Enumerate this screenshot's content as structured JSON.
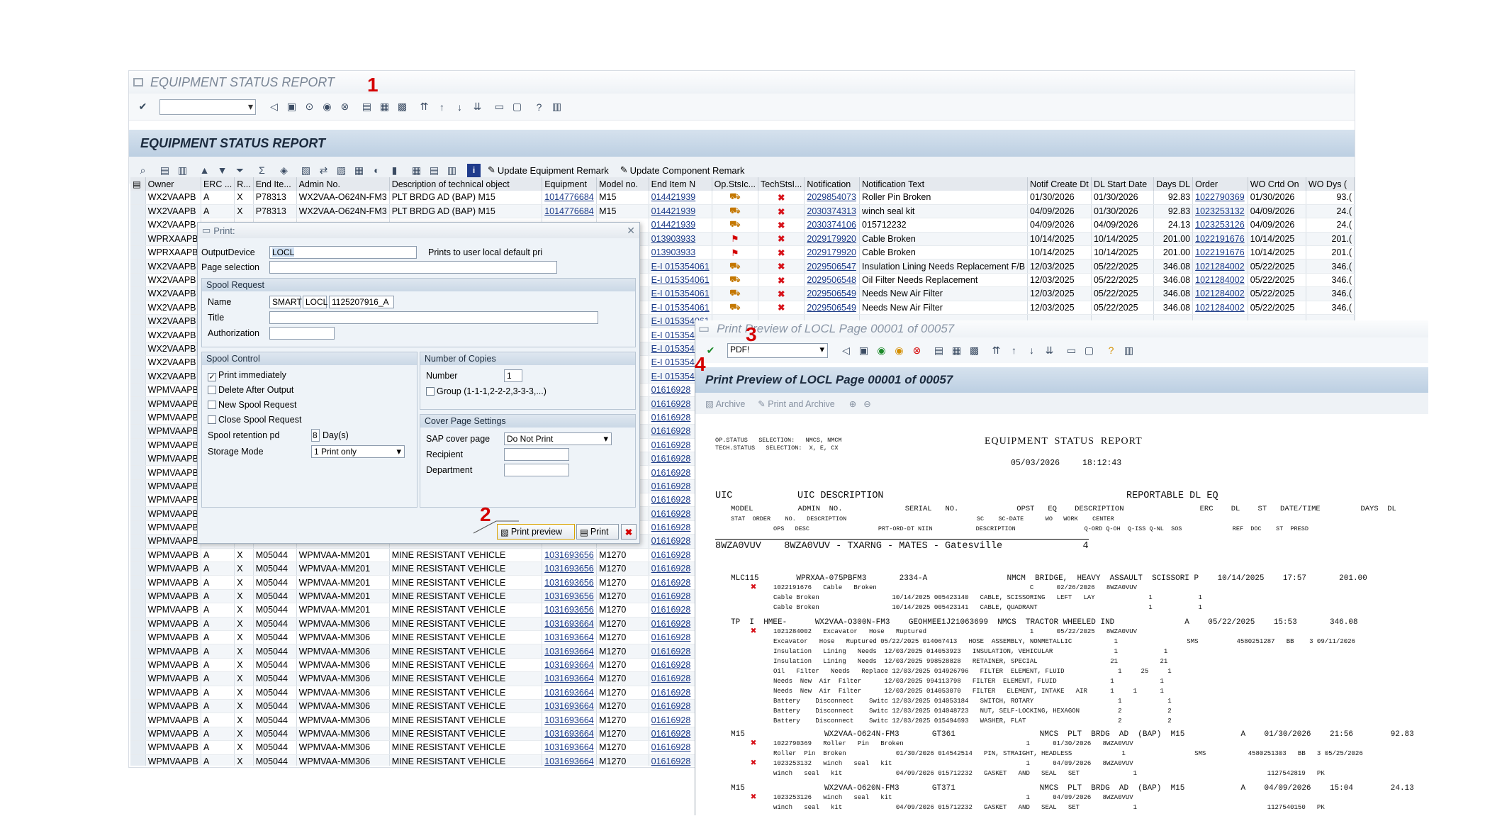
{
  "main_window": {
    "title": "EQUIPMENT STATUS REPORT",
    "app_title": "EQUIPMENT STATUS REPORT",
    "app_buttons": {
      "update_equipment": "Update Equipment Remark",
      "update_component": "Update Component Remark"
    }
  },
  "grid": {
    "columns": [
      "Owner",
      "ERC ...",
      "R...",
      "End Ite...",
      "Admin No.",
      "Description of technical object",
      "Equipment",
      "Model no.",
      "End Item N",
      "Op.StsIc...",
      "TechStsI...",
      "Notification",
      "Notification Text",
      "Notif Create Dt",
      "DL Start Date",
      "Days DL",
      "Order",
      "WO Crtd On",
      "WO Dys ("
    ],
    "rows": [
      [
        "WX2VAAPB",
        "A",
        "X",
        "P78313",
        "WX2VAA-O624N-FM3",
        "PLT BRDG AD (BAP) M15",
        "1014776684",
        "M15",
        "014421939",
        "truck",
        "x",
        "2029854073",
        "Roller Pin Broken",
        "01/30/2026",
        "01/30/2026",
        "92.83",
        "1022790369",
        "01/30/2026",
        "93.("
      ],
      [
        "WX2VAAPB",
        "A",
        "X",
        "P78313",
        "WX2VAA-O624N-FM3",
        "PLT BRDG AD (BAP) M15",
        "1014776684",
        "M15",
        "014421939",
        "truck",
        "x",
        "2030374313",
        "winch seal kit",
        "04/09/2026",
        "01/30/2026",
        "92.83",
        "1023253132",
        "04/09/2026",
        "24.("
      ],
      [
        "WX2VAAPB",
        "",
        "",
        "",
        "",
        "",
        "",
        "",
        "014421939",
        "truck",
        "x",
        "2030374106",
        "015712232",
        "04/09/2026",
        "04/09/2026",
        "24.13",
        "1023253126",
        "04/09/2026",
        "24.("
      ],
      [
        "WPRXAAPB",
        "",
        "",
        "",
        "",
        "",
        "",
        "",
        "013903933",
        "flag",
        "x",
        "2029179920",
        "Cable Broken",
        "10/14/2025",
        "10/14/2025",
        "201.00",
        "1022191676",
        "10/14/2025",
        "201.("
      ],
      [
        "WPRXAAPB",
        "",
        "",
        "",
        "",
        "",
        "",
        "",
        "013903933",
        "flag",
        "x",
        "2029179920",
        "Cable Broken",
        "10/14/2025",
        "10/14/2025",
        "201.00",
        "1022191676",
        "10/14/2025",
        "201.("
      ],
      [
        "WX2VAAPB",
        "",
        "",
        "",
        "",
        "",
        "",
        "",
        "E-I 015354061",
        "truck",
        "x",
        "2029506547",
        "Insulation Lining Needs Replacement F/B",
        "12/03/2025",
        "05/22/2025",
        "346.08",
        "1021284002",
        "05/22/2025",
        "346.("
      ],
      [
        "WX2VAAPB",
        "",
        "",
        "",
        "",
        "",
        "",
        "",
        "E-I 015354061",
        "truck",
        "x",
        "2029506548",
        "Oil Filter Needs Replacement",
        "12/03/2025",
        "05/22/2025",
        "346.08",
        "1021284002",
        "05/22/2025",
        "346.("
      ],
      [
        "WX2VAAPB",
        "",
        "",
        "",
        "",
        "",
        "",
        "",
        "E-I 015354061",
        "truck",
        "x",
        "2029506549",
        "Needs New Air Filter",
        "12/03/2025",
        "05/22/2025",
        "346.08",
        "1021284002",
        "05/22/2025",
        "346.("
      ],
      [
        "WX2VAAPB",
        "",
        "",
        "",
        "",
        "",
        "",
        "",
        "E-I 015354061",
        "truck",
        "x",
        "2029506549",
        "Needs New Air Filter",
        "12/03/2025",
        "05/22/2025",
        "346.08",
        "1021284002",
        "05/22/2025",
        "346.("
      ],
      [
        "WX2VAAPB",
        "",
        "",
        "",
        "",
        "",
        "",
        "",
        "E-I 015354061",
        "",
        "",
        "",
        "",
        "",
        "",
        "",
        "",
        "",
        ""
      ],
      [
        "WX2VAAPB",
        "",
        "",
        "",
        "",
        "",
        "",
        "",
        "E-I 015354061",
        "",
        "",
        "",
        "",
        "",
        "",
        "",
        "",
        "",
        ""
      ],
      [
        "WX2VAAPB",
        "",
        "",
        "",
        "",
        "",
        "",
        "",
        "E-I 015354061",
        "",
        "",
        "",
        "",
        "",
        "",
        "",
        "",
        "",
        ""
      ],
      [
        "WX2VAAPB",
        "",
        "",
        "",
        "",
        "",
        "",
        "",
        "E-I 015354061",
        "",
        "",
        "",
        "",
        "",
        "",
        "",
        "",
        "",
        ""
      ],
      [
        "WX2VAAPB",
        "",
        "",
        "",
        "",
        "",
        "",
        "",
        "E-I 015354061",
        "",
        "",
        "",
        "",
        "",
        "",
        "",
        "",
        "",
        ""
      ],
      [
        "WPMVAAPB",
        "",
        "",
        "",
        "",
        "",
        "",
        "",
        "01616928",
        "",
        "",
        "",
        "",
        "",
        "",
        "",
        "",
        "",
        ""
      ],
      [
        "WPMVAAPB",
        "",
        "",
        "",
        "",
        "",
        "",
        "",
        "01616928",
        "",
        "",
        "",
        "",
        "",
        "",
        "",
        "",
        "",
        ""
      ],
      [
        "WPMVAAPB",
        "",
        "",
        "",
        "",
        "",
        "",
        "",
        "01616928",
        "",
        "",
        "",
        "",
        "",
        "",
        "",
        "",
        "",
        ""
      ],
      [
        "WPMVAAPB",
        "",
        "",
        "",
        "",
        "",
        "",
        "",
        "01616928",
        "",
        "",
        "",
        "",
        "",
        "",
        "",
        "",
        "",
        ""
      ],
      [
        "WPMVAAPB",
        "",
        "",
        "",
        "",
        "",
        "",
        "",
        "01616928",
        "",
        "",
        "",
        "",
        "",
        "",
        "",
        "",
        "",
        ""
      ],
      [
        "WPMVAAPB",
        "",
        "",
        "",
        "",
        "",
        "",
        "",
        "01616928",
        "",
        "",
        "",
        "",
        "",
        "",
        "",
        "",
        "",
        ""
      ],
      [
        "WPMVAAPB",
        "",
        "",
        "",
        "",
        "",
        "",
        "",
        "01616928",
        "",
        "",
        "",
        "",
        "",
        "",
        "",
        "",
        "",
        ""
      ],
      [
        "WPMVAAPB",
        "",
        "",
        "",
        "",
        "",
        "",
        "",
        "01616928",
        "",
        "",
        "",
        "",
        "",
        "",
        "",
        "",
        "",
        ""
      ],
      [
        "WPMVAAPB",
        "",
        "",
        "",
        "",
        "",
        "",
        "",
        "01616928",
        "",
        "",
        "",
        "",
        "",
        "",
        "",
        "",
        "",
        ""
      ],
      [
        "WPMVAAPB",
        "",
        "",
        "",
        "",
        "",
        "",
        "",
        "01616928",
        "",
        "",
        "",
        "",
        "",
        "",
        "",
        "",
        "",
        ""
      ],
      [
        "WPMVAAPB",
        "",
        "",
        "",
        "",
        "",
        "",
        "",
        "01616928",
        "",
        "",
        "",
        "",
        "",
        "",
        "",
        "",
        "",
        ""
      ],
      [
        "WPMVAAPB",
        "",
        "",
        "",
        "",
        "",
        "",
        "",
        "01616928",
        "",
        "",
        "",
        "",
        "",
        "",
        "",
        "",
        "",
        ""
      ],
      [
        "WPMVAAPB",
        "A",
        "X",
        "M05044",
        "WPMVAA-MM201",
        "MINE RESISTANT VEHICLE",
        "1031693656",
        "M1270",
        "01616928",
        "",
        "",
        "",
        "",
        "",
        "",
        "",
        "",
        "",
        ""
      ],
      [
        "WPMVAAPB",
        "A",
        "X",
        "M05044",
        "WPMVAA-MM201",
        "MINE RESISTANT VEHICLE",
        "1031693656",
        "M1270",
        "01616928",
        "",
        "",
        "",
        "",
        "",
        "",
        "",
        "",
        "",
        ""
      ],
      [
        "WPMVAAPB",
        "A",
        "X",
        "M05044",
        "WPMVAA-MM201",
        "MINE RESISTANT VEHICLE",
        "1031693656",
        "M1270",
        "01616928",
        "",
        "",
        "",
        "",
        "",
        "",
        "",
        "",
        "",
        ""
      ],
      [
        "WPMVAAPB",
        "A",
        "X",
        "M05044",
        "WPMVAA-MM201",
        "MINE RESISTANT VEHICLE",
        "1031693656",
        "M1270",
        "01616928",
        "",
        "",
        "",
        "",
        "",
        "",
        "",
        "",
        "",
        ""
      ],
      [
        "WPMVAAPB",
        "A",
        "X",
        "M05044",
        "WPMVAA-MM201",
        "MINE RESISTANT VEHICLE",
        "1031693656",
        "M1270",
        "01616928",
        "",
        "",
        "",
        "",
        "",
        "",
        "",
        "",
        "",
        ""
      ],
      [
        "WPMVAAPB",
        "A",
        "X",
        "M05044",
        "WPMVAA-MM306",
        "MINE RESISTANT VEHICLE",
        "1031693664",
        "M1270",
        "01616928",
        "",
        "",
        "",
        "",
        "",
        "",
        "",
        "",
        "",
        ""
      ],
      [
        "WPMVAAPB",
        "A",
        "X",
        "M05044",
        "WPMVAA-MM306",
        "MINE RESISTANT VEHICLE",
        "1031693664",
        "M1270",
        "01616928",
        "",
        "",
        "",
        "",
        "",
        "",
        "",
        "",
        "",
        ""
      ],
      [
        "WPMVAAPB",
        "A",
        "X",
        "M05044",
        "WPMVAA-MM306",
        "MINE RESISTANT VEHICLE",
        "1031693664",
        "M1270",
        "01616928",
        "",
        "",
        "",
        "",
        "",
        "",
        "",
        "",
        "",
        ""
      ],
      [
        "WPMVAAPB",
        "A",
        "X",
        "M05044",
        "WPMVAA-MM306",
        "MINE RESISTANT VEHICLE",
        "1031693664",
        "M1270",
        "01616928",
        "",
        "",
        "",
        "",
        "",
        "",
        "",
        "",
        "",
        ""
      ],
      [
        "WPMVAAPB",
        "A",
        "X",
        "M05044",
        "WPMVAA-MM306",
        "MINE RESISTANT VEHICLE",
        "1031693664",
        "M1270",
        "01616928",
        "",
        "",
        "",
        "",
        "",
        "",
        "",
        "",
        "",
        ""
      ],
      [
        "WPMVAAPB",
        "A",
        "X",
        "M05044",
        "WPMVAA-MM306",
        "MINE RESISTANT VEHICLE",
        "1031693664",
        "M1270",
        "01616928",
        "",
        "",
        "",
        "",
        "",
        "",
        "",
        "",
        "",
        ""
      ],
      [
        "WPMVAAPB",
        "A",
        "X",
        "M05044",
        "WPMVAA-MM306",
        "MINE RESISTANT VEHICLE",
        "1031693664",
        "M1270",
        "01616928",
        "",
        "",
        "",
        "",
        "",
        "",
        "",
        "",
        "",
        ""
      ],
      [
        "WPMVAAPB",
        "A",
        "X",
        "M05044",
        "WPMVAA-MM306",
        "MINE RESISTANT VEHICLE",
        "1031693664",
        "M1270",
        "01616928",
        "",
        "",
        "",
        "",
        "",
        "",
        "",
        "",
        "",
        ""
      ],
      [
        "WPMVAAPB",
        "A",
        "X",
        "M05044",
        "WPMVAA-MM306",
        "MINE RESISTANT VEHICLE",
        "1031693664",
        "M1270",
        "01616928",
        "",
        "",
        "",
        "",
        "",
        "",
        "",
        "",
        "",
        ""
      ],
      [
        "WPMVAAPB",
        "A",
        "X",
        "M05044",
        "WPMVAA-MM306",
        "MINE RESISTANT VEHICLE",
        "1031693664",
        "M1270",
        "01616928",
        "",
        "",
        "",
        "",
        "",
        "",
        "",
        "",
        "",
        ""
      ],
      [
        "WPMVAAPB",
        "A",
        "X",
        "M05044",
        "WPMVAA-MM306",
        "MINE RESISTANT VEHICLE",
        "1031693664",
        "M1270",
        "01616928",
        "",
        "",
        "",
        "",
        "",
        "",
        "",
        "",
        "",
        ""
      ]
    ]
  },
  "print_dialog": {
    "title": "Print:",
    "output_device_label": "OutputDevice",
    "output_device_value": "LOCL",
    "output_device_desc": "Prints to user local default pri",
    "page_selection_label": "Page selection",
    "spool_request": {
      "heading": "Spool Request",
      "name_label": "Name",
      "name_1": "SMART",
      "name_2": "LOCL",
      "name_3": "1125207916_A",
      "title_label": "Title",
      "authorization_label": "Authorization"
    },
    "spool_control": {
      "heading": "Spool Control",
      "print_immediately": "Print immediately",
      "delete_after": "Delete After Output",
      "new_spool": "New Spool Request",
      "close_spool": "Close Spool Request",
      "retention_label": "Spool retention pd",
      "retention_value": "8",
      "retention_unit": "Day(s)",
      "storage_label": "Storage Mode",
      "storage_value": "1 Print only"
    },
    "copies": {
      "heading": "Number of Copies",
      "number_label": "Number",
      "number_value": "1",
      "group_label": "Group (1-1-1,2-2-2,3-3-3,...)"
    },
    "cover": {
      "heading": "Cover Page Settings",
      "sap_cover_label": "SAP cover page",
      "sap_cover_value": "Do Not Print",
      "recipient_label": "Recipient",
      "department_label": "Department"
    },
    "buttons": {
      "print_preview": "Print preview",
      "print": "Print"
    }
  },
  "preview": {
    "window_title": "Print Preview of LOCL Page 00001 of 00057",
    "format_value": "PDF!",
    "app_title": "Print Preview of LOCL Page 00001 of 00057",
    "archive": "Archive",
    "print_archive": "Print and Archive"
  },
  "report": {
    "sel1": "OP.STATUS   SELECTION:   NMCS, NMCM",
    "sel2": "TECH.STATUS   SELECTION:  X, E, CX",
    "title": "EQUIPMENT  STATUS  REPORT",
    "date": "05/03/2026",
    "time": "18:12:43",
    "h_uic": "UIC",
    "h_uicdesc": "UIC DESCRIPTION",
    "h_rep": "REPORTABLE DL EQ",
    "h2": "MODEL          ADMIN  NO.              SERIAL   NO.             OPST   EQ    DESCRIPTION                 ERC    DL    ST   DATE/TIME         DAYS  DL",
    "h3": "STAT  ORDER    NO.   DESCRIPTION                                    SC    SC-DATE      WO   WORK    CENTER",
    "h4": "OPS   DESC                   PRT-ORD-DT NIIN            DESCRIPTION                   Q-ORD Q-OH  Q-ISS Q-NL  SOS              REF  DOC    ST  PRESD",
    "unit": "8WZA0VUV    8WZA0VUV - TXARNG - MATES - Gatesville              4",
    "l1": "MLC115        WPRXAA-075PBFM3       2334-A                 NMCM  BRIDGE,  HEAVY  ASSAULT  SCISSORI P    10/14/2025    17:57       201.00",
    "l2": "1022191676   Cable   Broken                                        C      02/26/2026   8WZA0VUV",
    "l3": "Cable Broken                   10/14/2025 005423140   CABLE, SCISSORING   LEFT   LAY              1            1",
    "l4": "Cable Broken                   10/14/2025 005423141   CABLE, QUADRANT                             1            1",
    "l5": "TP  I  HMEE-      WX2VAA-O300N-FM3    GEOHMEE1J21063699  NMCS  TRACTOR WHEELED IND               A    05/22/2025    15:53       346.08",
    "l6": "1021284002   Excavator   Hose   Ruptured                           1      05/22/2025   8WZA0VUV",
    "l7": "Excavator   Hose   Ruptured 05/22/2025 014067413   HOSE  ASSEMBLY, NONMETALLIC           1                  SMS          4580251287   BB    3 09/11/2026",
    "l8": "Insulation   Lining   Needs  12/03/2025 014053923   INSULATION, VEHICULAR                1            1",
    "l9": "Insulation   Lining   Needs  12/03/2025 998528828   RETAINER, SPECIAL                   21           21",
    "l10": "Oil   Filter   Needs   Replace 12/03/2025 014926796   FILTER  ELEMENT, FLUID              1     25     1",
    "l11": "Needs  New  Air  Filter      12/03/2025 994113798   FILTER  ELEMENT, FLUID              1            1",
    "l12": "Needs  New  Air  Filter      12/03/2025 014053070   FILTER   ELEMENT, INTAKE   AIR      1     1      1",
    "l13": "Battery    Disconnect    Switc 12/03/2025 014053184   SWITCH, ROTARY                      1            1",
    "l14": "Battery    Disconnect    Switc 12/03/2025 014048723   NUT, SELF-LOCKING, HEXAGON          2            2",
    "l15": "Battery    Disconnect    Switc 12/03/2025 015494693   WASHER, FLAT                        2            2",
    "l16": "M15                 WX2VAA-O624N-FM3       GT361                  NMCS  PLT  BRDG  AD  (BAP)  M15            A    01/30/2026    21:56        92.83",
    "l17": "1022790369   Roller   Pin   Broken                                1      01/30/2026   8WZA0VUV",
    "l18": "Roller  Pin  Broken             01/30/2026 014542514   PIN, STRAIGHT, HEADLESS             1                  SMS           4580251303   BB   3 05/25/2026",
    "l19": "1023253132   winch   seal   kit                                   1      04/09/2026   8WZA0VUV",
    "l20": "winch   seal   kit              04/09/2026 015712232   GASKET   AND   SEAL   SET              1                                  1127542819   PK",
    "l21": "M15                 WX2VAA-O620N-FM3       GT371                  NMCS  PLT  BRDG  AD  (BAP)  M15            A    04/09/2026    15:04        24.13",
    "l22": "1023253126   winch   seal   kit                                   1      04/09/2026   8WZA0VUV",
    "l23": "winch   seal   kit              04/09/2026 015712232   GASKET   AND   SEAL   SET              1                                  1127540150   PK"
  },
  "annotations": [
    "1",
    "2",
    "3",
    "4"
  ]
}
